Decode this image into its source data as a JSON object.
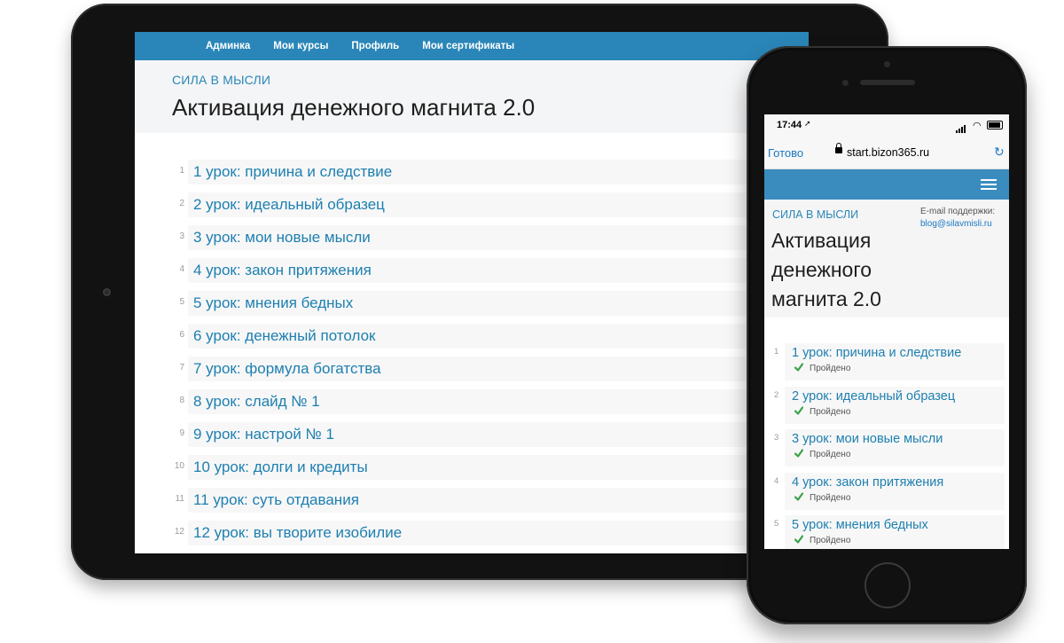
{
  "tablet": {
    "nav": [
      "Админка",
      "Мои курсы",
      "Профиль",
      "Мои сертификаты"
    ],
    "brand": "СИЛА В МЫСЛИ",
    "title": "Активация денежного магнита 2.0",
    "lessons": [
      {
        "num": "1",
        "title": "1 урок: причина и следствие"
      },
      {
        "num": "2",
        "title": "2 урок: идеальный образец"
      },
      {
        "num": "3",
        "title": "3 урок: мои новые мысли"
      },
      {
        "num": "4",
        "title": "4 урок: закон притяжения"
      },
      {
        "num": "5",
        "title": "5 урок: мнения бедных"
      },
      {
        "num": "6",
        "title": "6 урок: денежный потолок"
      },
      {
        "num": "7",
        "title": "7 урок: формула богатства"
      },
      {
        "num": "8",
        "title": "8 урок: слайд № 1"
      },
      {
        "num": "9",
        "title": "9 урок: настрой № 1"
      },
      {
        "num": "10",
        "title": "10 урок: долги и кредиты"
      },
      {
        "num": "11",
        "title": "11 урок: суть отдавания"
      },
      {
        "num": "12",
        "title": "12 урок: вы творите изобилие"
      }
    ]
  },
  "phone": {
    "status_time": "17:44",
    "browser_done": "Готово",
    "url": "start.bizon365.ru",
    "brand": "СИЛА В МЫСЛИ",
    "support_label": "E-mail поддержки:",
    "support_email": "blog@silavmisli.ru",
    "title": "Активация денежного магнита 2.0",
    "lessons": [
      {
        "num": "1",
        "title": "1 урок: причина и следствие",
        "status": "Пройдено"
      },
      {
        "num": "2",
        "title": "2 урок: идеальный образец",
        "status": "Пройдено"
      },
      {
        "num": "3",
        "title": "3 урок: мои новые мысли",
        "status": "Пройдено"
      },
      {
        "num": "4",
        "title": "4 урок: закон притяжения",
        "status": "Пройдено"
      },
      {
        "num": "5",
        "title": "5 урок: мнения бедных",
        "status": "Пройдено"
      }
    ]
  },
  "colors": {
    "accent": "#2a86b8",
    "link": "#1d7fb0",
    "check": "#3aa348",
    "device": "#121212"
  }
}
